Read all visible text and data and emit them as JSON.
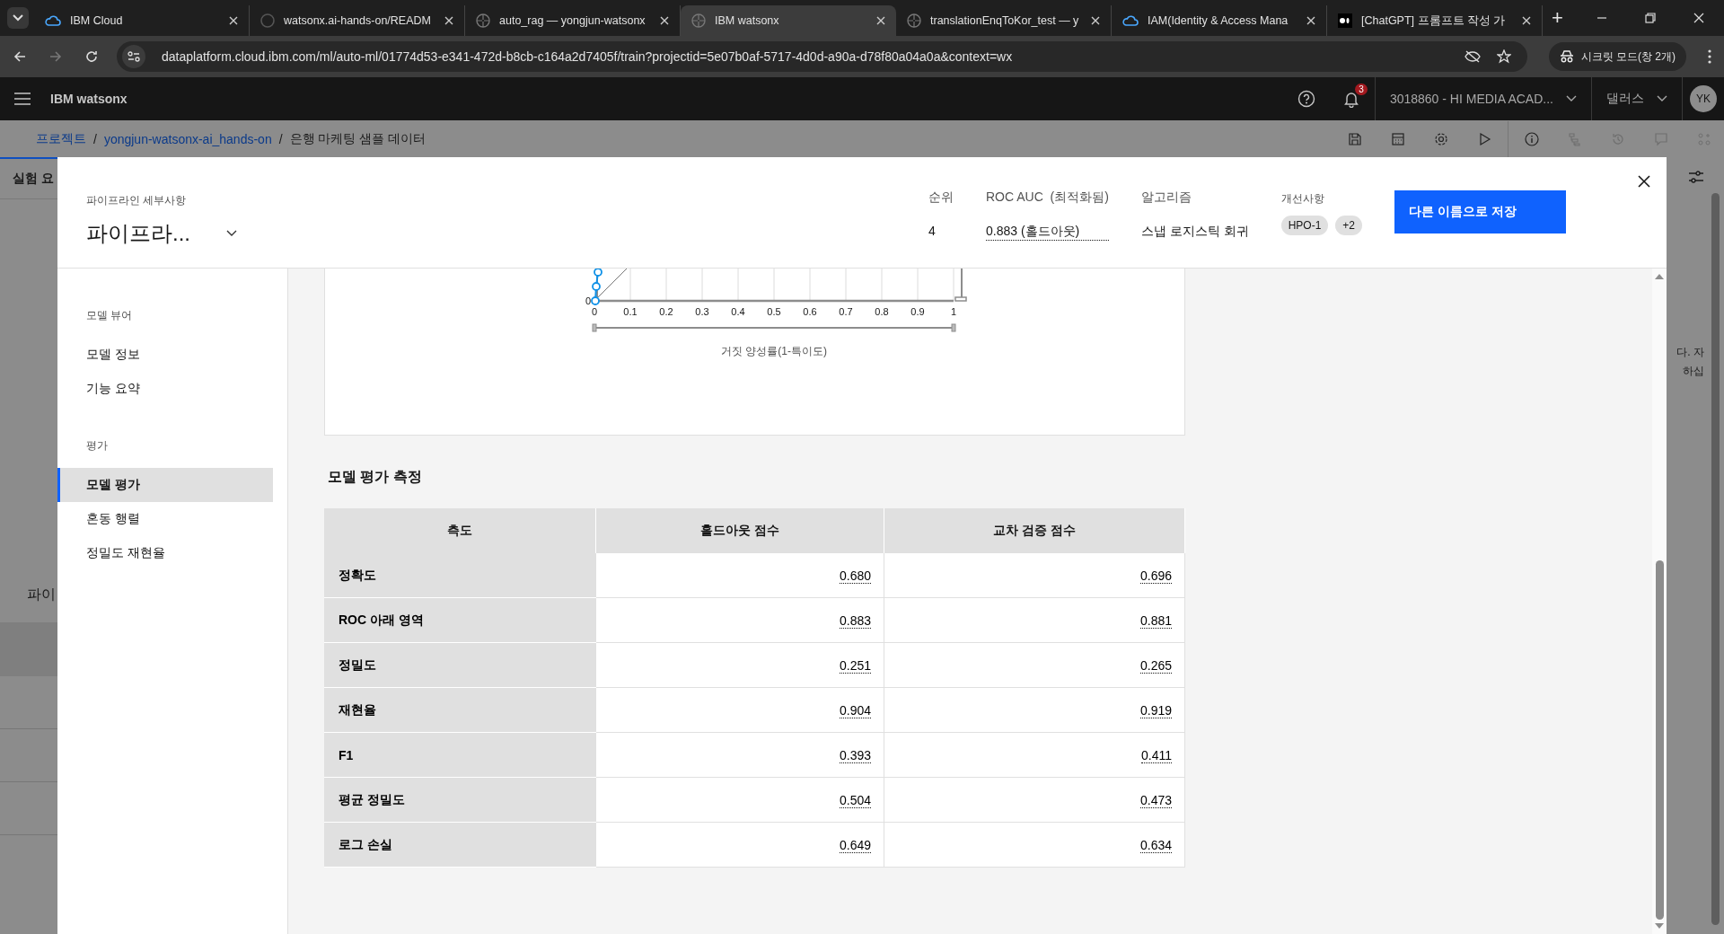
{
  "browser": {
    "tabs": [
      {
        "title": "IBM Cloud",
        "kind": "cloud",
        "selected": false
      },
      {
        "title": "watsonx.ai-hands-on/READM",
        "kind": "github",
        "selected": false
      },
      {
        "title": "auto_rag — yongjun-watsonx",
        "kind": "aperture",
        "selected": false
      },
      {
        "title": "IBM watsonx",
        "kind": "aperture",
        "selected": true
      },
      {
        "title": "translationEnqToKor_test — y",
        "kind": "aperture",
        "selected": false
      },
      {
        "title": "IAM(Identity & Access Mana",
        "kind": "cloud",
        "selected": false
      },
      {
        "title": "[ChatGPT] 프롬프트 작성 가",
        "kind": "medium",
        "selected": false
      }
    ],
    "new_tab": "+",
    "url": "dataplatform.cloud.ibm.com/ml/auto-ml/01774d53-e341-472d-b8cb-c164a2d7405f/train?projectid=5e07b0af-5717-4d0d-a90a-d78f80a04a0a&context=wx",
    "incognito": "시크릿 모드(창 2개)"
  },
  "app_header": {
    "product": "IBM watsonx",
    "notifications": "3",
    "account": "3018860 - HI MEDIA ACAD...",
    "region": "댈러스",
    "avatar": "YK"
  },
  "breadcrumb": {
    "separator": "/",
    "items": [
      "프로젝트",
      "yongjun-watsonx-ai_hands-on",
      "은행 마케팅 샘플 데이터"
    ]
  },
  "background": {
    "left_tab": "실험 요",
    "left_heading": "파이",
    "right_text": [
      "다. 자",
      "하십"
    ]
  },
  "modal": {
    "label": "파이프라인 세부사항",
    "title": "파이프라...",
    "stats": [
      {
        "label": "순위",
        "value": "4",
        "underlined": false
      },
      {
        "label": "ROC AUC  (최적화됨)",
        "value": "0.883 (홀드아웃)",
        "underlined": true
      },
      {
        "label": "알고리즘",
        "value": "스냅 로지스틱 회귀",
        "underlined": false
      }
    ],
    "enhancements": {
      "label": "개선사항",
      "tags": [
        "HPO-1",
        "+2"
      ]
    },
    "save_button": "다른 이름으로 저장",
    "nav": [
      {
        "heading": "모델 뷰어",
        "items": [
          {
            "label": "모델 정보",
            "selected": false
          },
          {
            "label": "기능 요약",
            "selected": false
          }
        ]
      },
      {
        "heading": "평가",
        "items": [
          {
            "label": "모델 평가",
            "selected": true
          },
          {
            "label": "혼동 행렬",
            "selected": false
          },
          {
            "label": "정밀도 재현율",
            "selected": false
          }
        ]
      }
    ],
    "roc": {
      "y_tick": "0",
      "x_ticks": [
        "0",
        "0.1",
        "0.2",
        "0.3",
        "0.4",
        "0.5",
        "0.6",
        "0.7",
        "0.8",
        "0.9",
        "1"
      ],
      "x_title": "거짓 양성률(1-특이도)"
    },
    "metrics": {
      "title": "모델 평가 측정",
      "columns": [
        "측도",
        "홀드아웃 점수",
        "교차 검증 점수"
      ],
      "rows": [
        {
          "name": "정확도",
          "holdout": "0.680",
          "cv": "0.696"
        },
        {
          "name": "ROC 아래 영역",
          "holdout": "0.883",
          "cv": "0.881"
        },
        {
          "name": "정밀도",
          "holdout": "0.251",
          "cv": "0.265"
        },
        {
          "name": "재현율",
          "holdout": "0.904",
          "cv": "0.919"
        },
        {
          "name": "F1",
          "holdout": "0.393",
          "cv": "0.411"
        },
        {
          "name": "평균 정밀도",
          "holdout": "0.504",
          "cv": "0.473"
        },
        {
          "name": "로그 손실",
          "holdout": "0.649",
          "cv": "0.634"
        }
      ]
    }
  }
}
